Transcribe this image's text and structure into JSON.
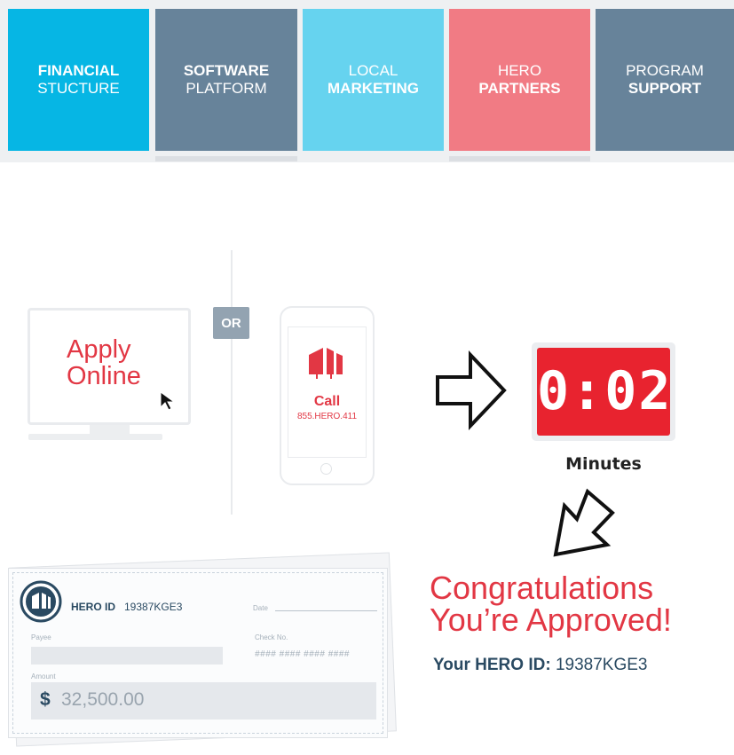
{
  "nav": {
    "tabs": [
      {
        "line1": "FINANCIAL",
        "line2": "STUCTURE",
        "bold_line": 1,
        "color": "#06b6e4"
      },
      {
        "line1": "SOFTWARE",
        "line2": "PLATFORM",
        "bold_line": 1,
        "color": "#67839a"
      },
      {
        "line1": "LOCAL",
        "line2": "MARKETING",
        "bold_line": 2,
        "color": "#66d3ef"
      },
      {
        "line1": "HERO",
        "line2": "PARTNERS",
        "bold_line": 2,
        "color": "#f17b84"
      },
      {
        "line1": "PROGRAM",
        "line2": "SUPPORT",
        "bold_line": 2,
        "color": "#67839a"
      }
    ]
  },
  "apply": {
    "line1": "Apply",
    "line2": "Online"
  },
  "or_label": "OR",
  "phone": {
    "call": "Call",
    "number": "855.HERO.411"
  },
  "timer": {
    "digits": "0:02",
    "label": "Minutes"
  },
  "check": {
    "id_title": "HERO ID",
    "id_value": "19387KGE3",
    "date_label": "Date",
    "payee_label": "Payee",
    "check_no_label": "Check No.",
    "check_no_value": "#### #### #### ####",
    "amount_label": "Amount",
    "currency": "$",
    "amount": "32,500.00"
  },
  "congrats": {
    "line1": "Congratulations",
    "line2": "You’re Approved!",
    "id_label": "Your HERO ID:",
    "id_value": "19387KGE3"
  },
  "colors": {
    "brand_red": "#e23744",
    "navy": "#2a4a62",
    "timer_red": "#e8232f"
  }
}
